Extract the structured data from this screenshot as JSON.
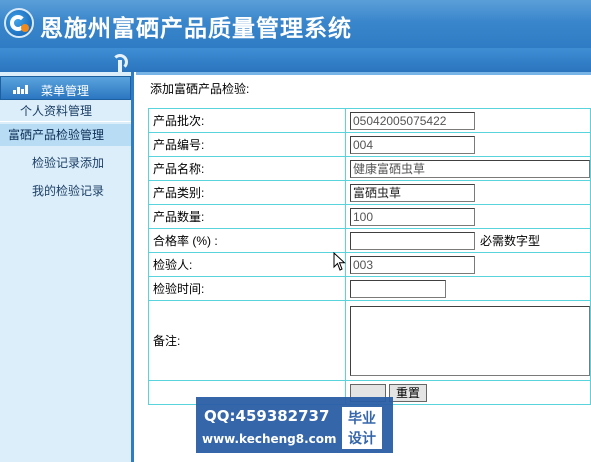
{
  "app": {
    "title": "恩施州富硒产品质量管理系统"
  },
  "sidebar": {
    "menu_label": "菜单管理",
    "items": [
      {
        "label": "个人资料管理"
      },
      {
        "label": "富硒产品检验管理"
      },
      {
        "label": "检验记录添加"
      },
      {
        "label": "我的检验记录"
      }
    ]
  },
  "form": {
    "title": "添加富硒产品检验:",
    "fields": [
      {
        "label": "产品批次:",
        "value": "05042005075422"
      },
      {
        "label": "产品编号:",
        "value": "004"
      },
      {
        "label": "产品名称:",
        "value": "健康富硒虫草"
      },
      {
        "label": "产品类别:",
        "value": "富硒虫草"
      },
      {
        "label": "产品数量:",
        "value": "100"
      },
      {
        "label": "合格率 (%) :",
        "value": "",
        "hint": "必需数字型"
      },
      {
        "label": "检验人:",
        "value": "003"
      },
      {
        "label": "检验时间:",
        "value": ""
      },
      {
        "label": "备注:",
        "value": ""
      }
    ],
    "reset_label": "重置"
  },
  "watermark": {
    "qq": "QQ:459382737",
    "url": "www.kecheng8.com",
    "badge_line1": "毕业",
    "badge_line2": "设计"
  }
}
